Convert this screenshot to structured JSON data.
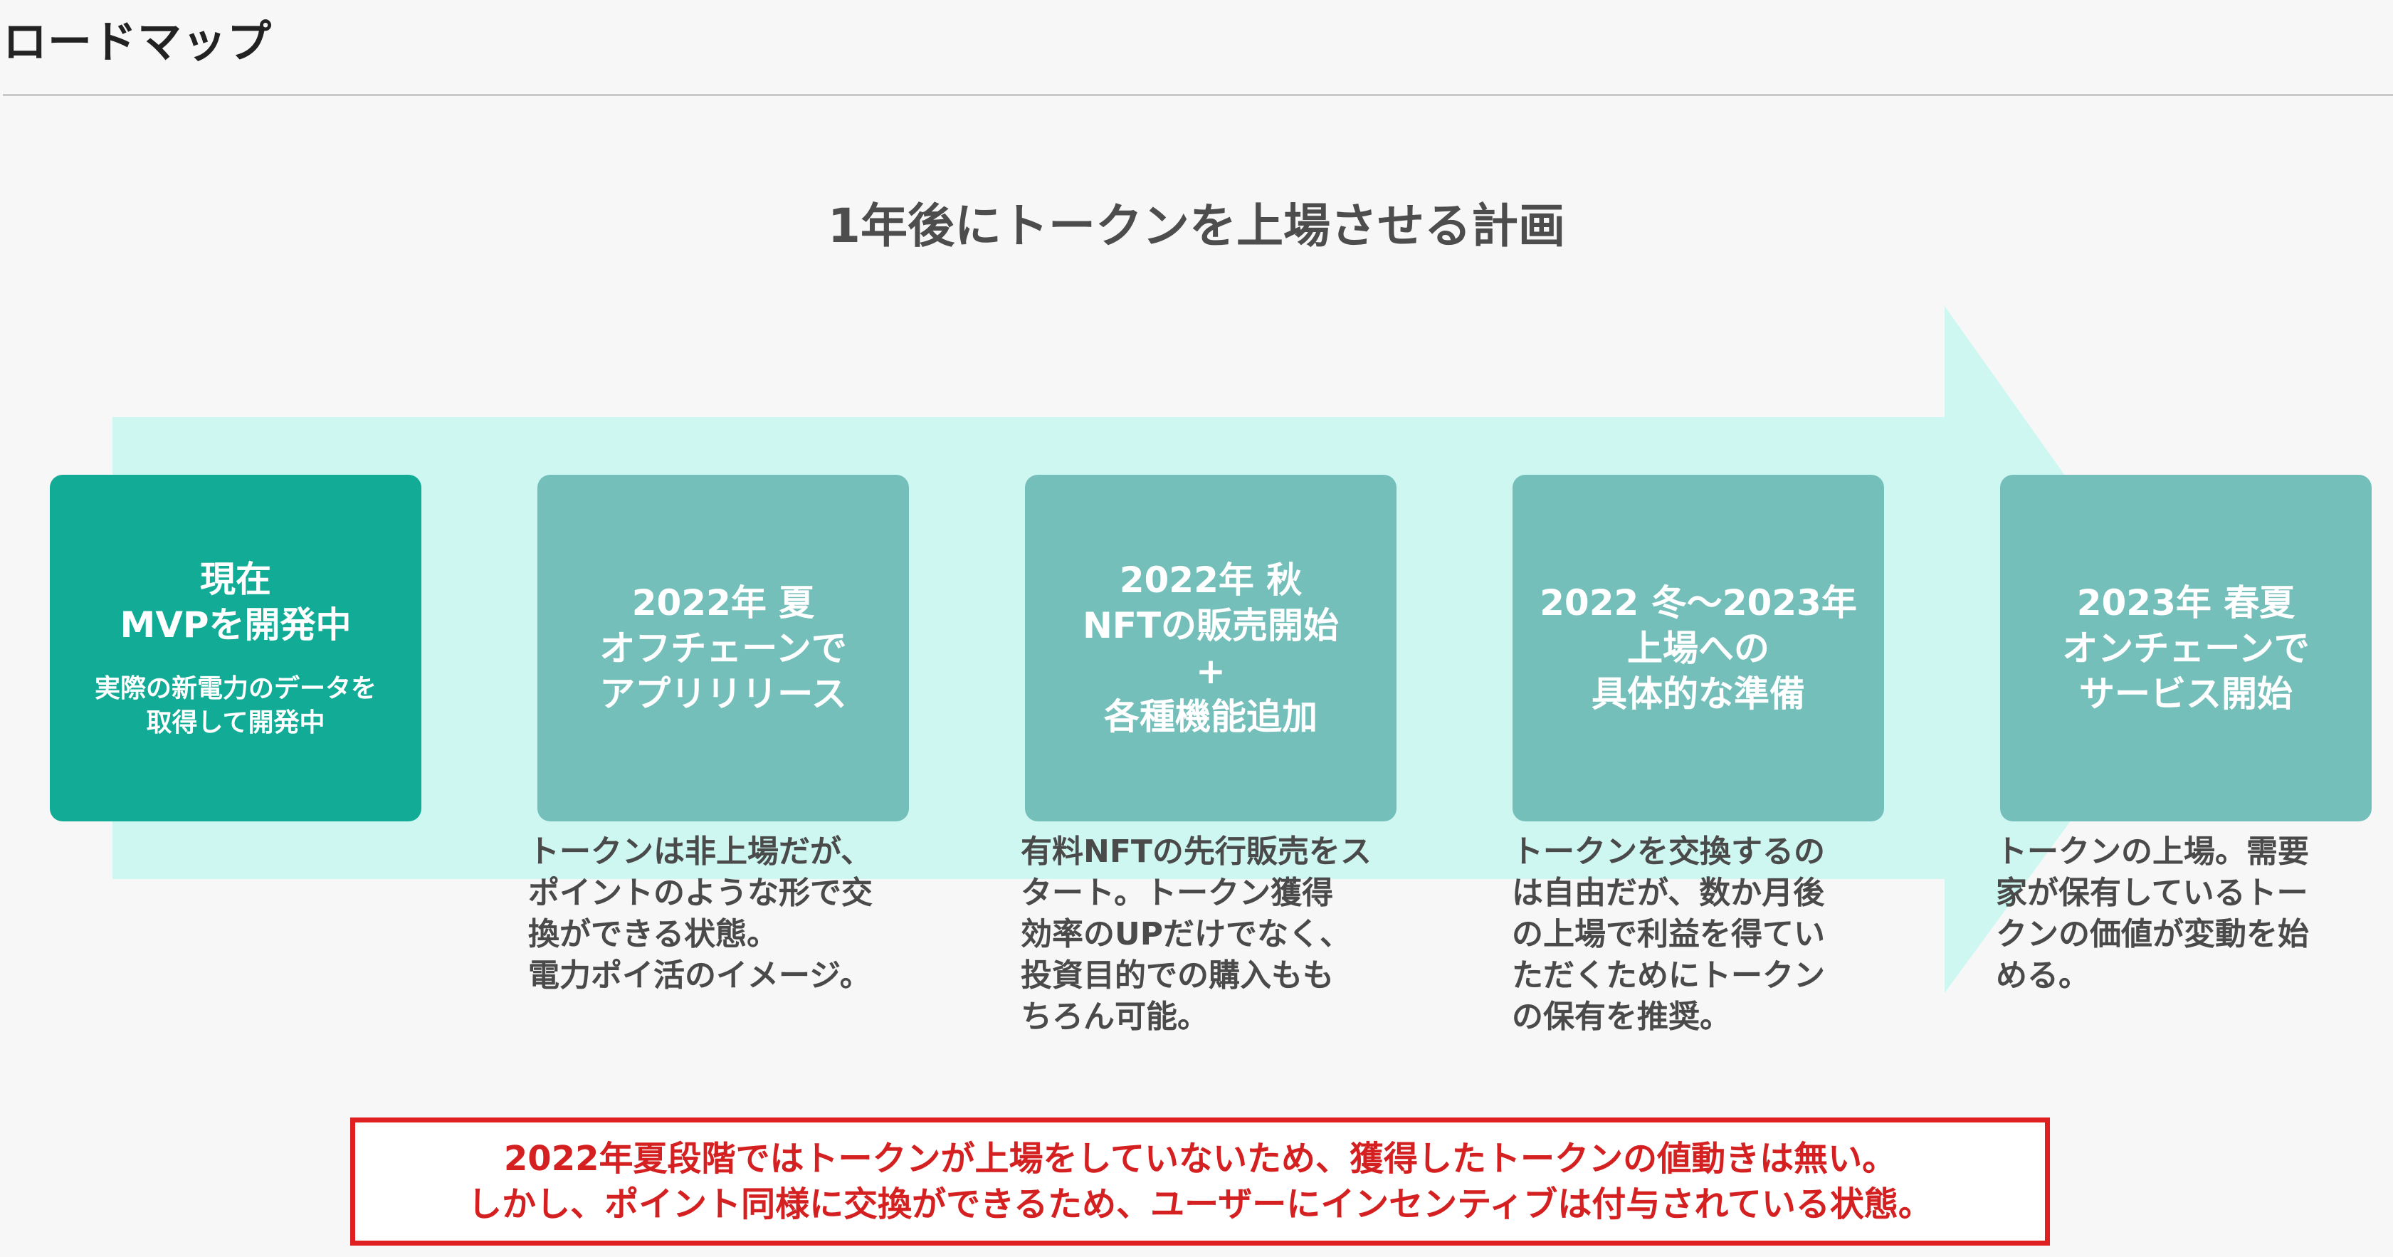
{
  "header": {
    "title": "ロードマップ"
  },
  "diagram": {
    "title": "1年後にトークンを上場させる計画",
    "arrow_color": "#cef7f2",
    "steps": [
      {
        "title": "現在\nMVPを開発中",
        "note": "実際の新電力のデータを\n取得して開発中",
        "description": "",
        "color": "#12ab96"
      },
      {
        "title": "2022年 夏\nオフチェーンで\nアプリリリース",
        "note": "",
        "description": "トークンは非上場だが、\nポイントのような形で交\n換ができる状態。\n電力ポイ活のイメージ。",
        "color": "#75bfbb"
      },
      {
        "title": "2022年 秋\nNFTの販売開始\n+\n各種機能追加",
        "note": "",
        "description": "有料NFTの先行販売をス\nタート。トークン獲得\n効率のUPだけでなく、\n投資目的での購入もも\nちろん可能。",
        "color": "#75bfbb"
      },
      {
        "title": "2022 冬～2023年\n上場への\n具体的な準備",
        "note": "",
        "description": "トークンを交換するの\nは自由だが、数か月後\nの上場で利益を得てい\nただくためにトークン\nの保有を推奨。",
        "color": "#75bfbb"
      },
      {
        "title": "2023年 春夏\nオンチェーンで\nサービス開始",
        "note": "",
        "description": "トークンの上場。需要\n家が保有しているトー\nクンの価値が変動を始\nめる。",
        "color": "#75bfbb"
      }
    ]
  },
  "notice": {
    "line1": "2022年夏段階ではトークンが上場をしていないため、獲得したトークンの値動きは無い。",
    "line2": "しかし、ポイント同様に交換ができるため、ユーザーにインセンティブは付与されている状態。",
    "border_color": "#e02020",
    "text_color": "#d42020"
  }
}
